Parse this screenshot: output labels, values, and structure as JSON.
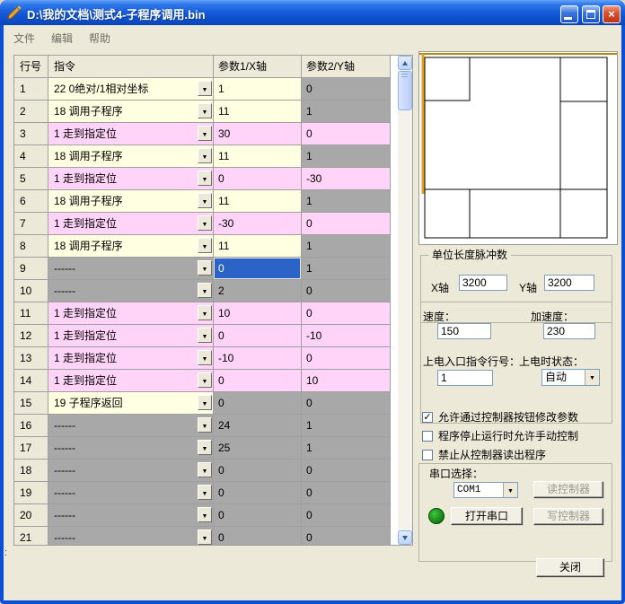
{
  "window": {
    "title": "D:\\我的文档\\测式4-子程序调用.bin"
  },
  "menu": {
    "items": [
      "文件",
      "编辑",
      "帮助"
    ]
  },
  "icons": {
    "close": "×",
    "dropdown": "▼",
    "check": "✓",
    "app_icon": "wrench-icon",
    "led": "green-circle-indicator"
  },
  "colors": {
    "titlebar_blue": "#1257D8",
    "client_beige": "#ECE9D8",
    "row_cream": "#FFFFE1",
    "row_pink": "#FFD4F8",
    "row_gray": "#A8A8A8",
    "selection_blue": "#2B63C6",
    "axis_orange": "#D89020",
    "trace_black": "#000000",
    "led_green": "#1E8A1E"
  },
  "table": {
    "headers": [
      "行号",
      "指令",
      "参数1/X轴",
      "参数2/Y轴"
    ],
    "rows": [
      {
        "num": "1",
        "cmd": "22 0绝对/1相对坐标",
        "p1": "1",
        "p2": "0",
        "cmd_bg": "cream",
        "p1_bg": "cream",
        "p2_bg": "gray"
      },
      {
        "num": "2",
        "cmd": "18 调用子程序",
        "p1": "11",
        "p2": "1",
        "cmd_bg": "cream",
        "p1_bg": "cream",
        "p2_bg": "gray"
      },
      {
        "num": "3",
        "cmd": "1 走到指定位",
        "p1": "30",
        "p2": "0",
        "cmd_bg": "pink",
        "p1_bg": "pink",
        "p2_bg": "pink"
      },
      {
        "num": "4",
        "cmd": "18 调用子程序",
        "p1": "11",
        "p2": "1",
        "cmd_bg": "cream",
        "p1_bg": "cream",
        "p2_bg": "gray"
      },
      {
        "num": "5",
        "cmd": "1 走到指定位",
        "p1": "0",
        "p2": "-30",
        "cmd_bg": "pink",
        "p1_bg": "pink",
        "p2_bg": "pink"
      },
      {
        "num": "6",
        "cmd": "18 调用子程序",
        "p1": "11",
        "p2": "1",
        "cmd_bg": "cream",
        "p1_bg": "cream",
        "p2_bg": "gray"
      },
      {
        "num": "7",
        "cmd": "1 走到指定位",
        "p1": "-30",
        "p2": "0",
        "cmd_bg": "pink",
        "p1_bg": "pink",
        "p2_bg": "pink"
      },
      {
        "num": "8",
        "cmd": "18 调用子程序",
        "p1": "11",
        "p2": "1",
        "cmd_bg": "cream",
        "p1_bg": "cream",
        "p2_bg": "gray"
      },
      {
        "num": "9",
        "cmd": "------",
        "p1": "0",
        "p2": "1",
        "cmd_bg": "gray",
        "p1_bg": "selected",
        "p2_bg": "gray"
      },
      {
        "num": "10",
        "cmd": "------",
        "p1": "2",
        "p2": "0",
        "cmd_bg": "gray",
        "p1_bg": "gray",
        "p2_bg": "gray"
      },
      {
        "num": "11",
        "cmd": "1 走到指定位",
        "p1": "10",
        "p2": "0",
        "cmd_bg": "pink",
        "p1_bg": "pink",
        "p2_bg": "pink"
      },
      {
        "num": "12",
        "cmd": "1 走到指定位",
        "p1": "0",
        "p2": "-10",
        "cmd_bg": "pink",
        "p1_bg": "pink",
        "p2_bg": "pink"
      },
      {
        "num": "13",
        "cmd": "1 走到指定位",
        "p1": "-10",
        "p2": "0",
        "cmd_bg": "pink",
        "p1_bg": "pink",
        "p2_bg": "pink"
      },
      {
        "num": "14",
        "cmd": "1 走到指定位",
        "p1": "0",
        "p2": "10",
        "cmd_bg": "pink",
        "p1_bg": "pink",
        "p2_bg": "pink"
      },
      {
        "num": "15",
        "cmd": "19 子程序返回",
        "p1": "0",
        "p2": "0",
        "cmd_bg": "cream",
        "p1_bg": "gray",
        "p2_bg": "gray"
      },
      {
        "num": "16",
        "cmd": "------",
        "p1": "24",
        "p2": "1",
        "cmd_bg": "gray",
        "p1_bg": "gray",
        "p2_bg": "gray"
      },
      {
        "num": "17",
        "cmd": "------",
        "p1": "25",
        "p2": "1",
        "cmd_bg": "gray",
        "p1_bg": "gray",
        "p2_bg": "gray"
      },
      {
        "num": "18",
        "cmd": "------",
        "p1": "0",
        "p2": "0",
        "cmd_bg": "gray",
        "p1_bg": "gray",
        "p2_bg": "gray"
      },
      {
        "num": "19",
        "cmd": "------",
        "p1": "0",
        "p2": "0",
        "cmd_bg": "gray",
        "p1_bg": "gray",
        "p2_bg": "gray"
      },
      {
        "num": "20",
        "cmd": "------",
        "p1": "0",
        "p2": "0",
        "cmd_bg": "gray",
        "p1_bg": "gray",
        "p2_bg": "gray"
      },
      {
        "num": "21",
        "cmd": "------",
        "p1": "0",
        "p2": "0",
        "cmd_bg": "gray",
        "p1_bg": "gray",
        "p2_bg": "gray"
      }
    ]
  },
  "panel": {
    "pulse_group": {
      "title": "单位长度脉冲数",
      "x_label": "X轴",
      "x_value": "3200",
      "y_label": "Y轴",
      "y_value": "3200"
    },
    "motion_group": {
      "speed_label": "速度：",
      "speed_value": "150",
      "accel_label": "加速度：",
      "accel_value": "230",
      "entry_label": "上电入口指令行号：",
      "entry_value": "1",
      "state_label": "上电时状态：",
      "state_value": "自动"
    },
    "checkboxes": [
      {
        "label": "允许通过控制器按钮修改参数",
        "checked": true
      },
      {
        "label": "程序停止运行时允许手动控制",
        "checked": false
      },
      {
        "label": "禁止从控制器读出程序",
        "checked": false
      }
    ],
    "serial": {
      "label": "串口选择：",
      "port": "COM1",
      "read_button": "读控制器",
      "open_button": "打开串口",
      "write_button": "写控制器"
    },
    "close_button": "关闭"
  },
  "misc": {
    "colon_artifact": ":"
  }
}
